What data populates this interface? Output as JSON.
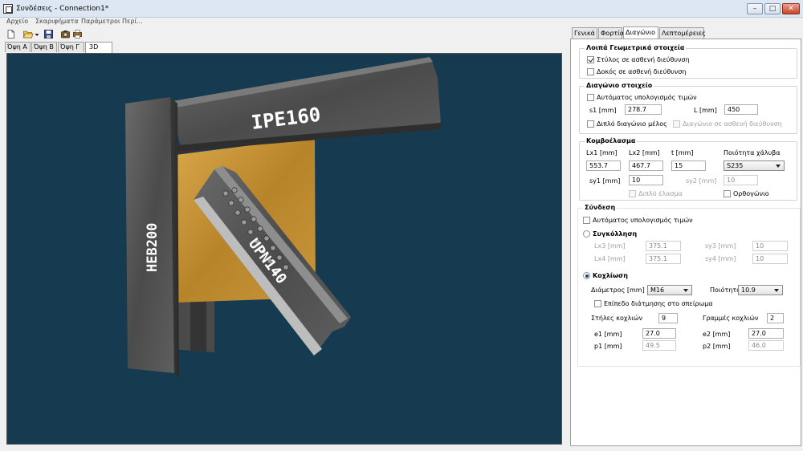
{
  "window": {
    "title": "Συνδέσεις - Connection1*",
    "min_label": "–",
    "max_label": "□",
    "close_label": "✕"
  },
  "menu": [
    "Αρχείο",
    "Σκαριφήματα",
    "Παράμετροι",
    "Περί..."
  ],
  "toolbar": {
    "icons": [
      "new-file-icon",
      "open-folder-icon",
      "save-icon",
      "camera-icon",
      "print-icon"
    ]
  },
  "view_tabs": [
    "Όψη Α",
    "Όψη Β",
    "Όψη Γ",
    "3D"
  ],
  "active_view_tab": "3D",
  "scene": {
    "beam_label": "IPE160",
    "column_label": "HEB200",
    "diagonal_label": "UPN140"
  },
  "colors": {
    "viewport_bg": "#163b50",
    "gusset": "#c8962e",
    "steel": "#5a5a5a"
  },
  "right_tabs": [
    "Γενικά",
    "Φορτία",
    "Διαγώνιο",
    "Λεπτομέρειες"
  ],
  "active_right_tab": "Διαγώνιο",
  "geometry": {
    "title": "Λοιπά Γεωμετρικά στοιχεία",
    "column_weak_axis": {
      "label": "Στύλος σε ασθενή διεύθυνση",
      "checked": true
    },
    "beam_weak_axis": {
      "label": "Δοκός σε ασθενή διεύθυνση",
      "checked": false
    }
  },
  "diagonal": {
    "title": "Διαγώνιο στοιχείο",
    "auto_calc": {
      "label": "Αυτόματος υπολογισμός τιμών",
      "checked": false
    },
    "s1_label": "s1 [mm]",
    "s1_value": "278.7",
    "L_label": "L [mm]",
    "L_value": "450",
    "double_member": {
      "label": "Διπλό διαγώνιο μέλος",
      "checked": false
    },
    "weak_axis": {
      "label": "Διαγώνιο σε ασθενή διεύθυνση",
      "checked": false
    }
  },
  "gusset": {
    "title": "Κομβοέλασμα",
    "lx1_label": "Lx1 [mm]",
    "lx1_value": "553.7",
    "lx2_label": "Lx2 [mm]",
    "lx2_value": "467.7",
    "t_label": "t [mm]",
    "t_value": "15",
    "steel_label": "Ποιότητα χάλυβα",
    "steel_value": "S235",
    "sy1_label": "sy1 [mm]",
    "sy1_value": "10",
    "sy2_label": "sy2 [mm]",
    "sy2_value": "10",
    "double_plate": {
      "label": "Διπλό έλασμα",
      "checked": false
    },
    "orthogonal": {
      "label": "Ορθογώνιο",
      "checked": false
    }
  },
  "connection": {
    "title": "Σύνδεση",
    "auto_calc": {
      "label": "Αυτόματος υπολογισμός τιμών",
      "checked": false
    },
    "welding": {
      "label": "Συγκόλληση",
      "selected": false
    },
    "lx3_label": "Lx3 [mm]",
    "lx3_value": "375.1",
    "lx4_label": "Lx4 [mm]",
    "lx4_value": "375.1",
    "sy3_label": "sy3 [mm]",
    "sy3_value": "10",
    "sy4_label": "sy4 [mm]",
    "sy4_value": "10",
    "bolting": {
      "label": "Κοχλίωση",
      "selected": true
    },
    "diameter_label": "Διάμετρος [mm]",
    "diameter_value": "M16",
    "grade_label": "Ποιότητα",
    "grade_value": "10.9",
    "shear_plane": {
      "label": "Επίπεδο διάτμησης στο σπείρωμα",
      "checked": false
    },
    "bolt_columns_label": "Στήλες κοχλιών",
    "bolt_columns_value": "9",
    "bolt_rows_label": "Γραμμές κοχλιών",
    "bolt_rows_value": "2",
    "e1_label": "e1 [mm]",
    "e1_value": "27.0",
    "e2_label": "e2 [mm]",
    "e2_value": "27.0",
    "p1_label": "p1 [mm]",
    "p1_value": "49.5",
    "p2_label": "p2 [mm]",
    "p2_value": "46.0"
  }
}
